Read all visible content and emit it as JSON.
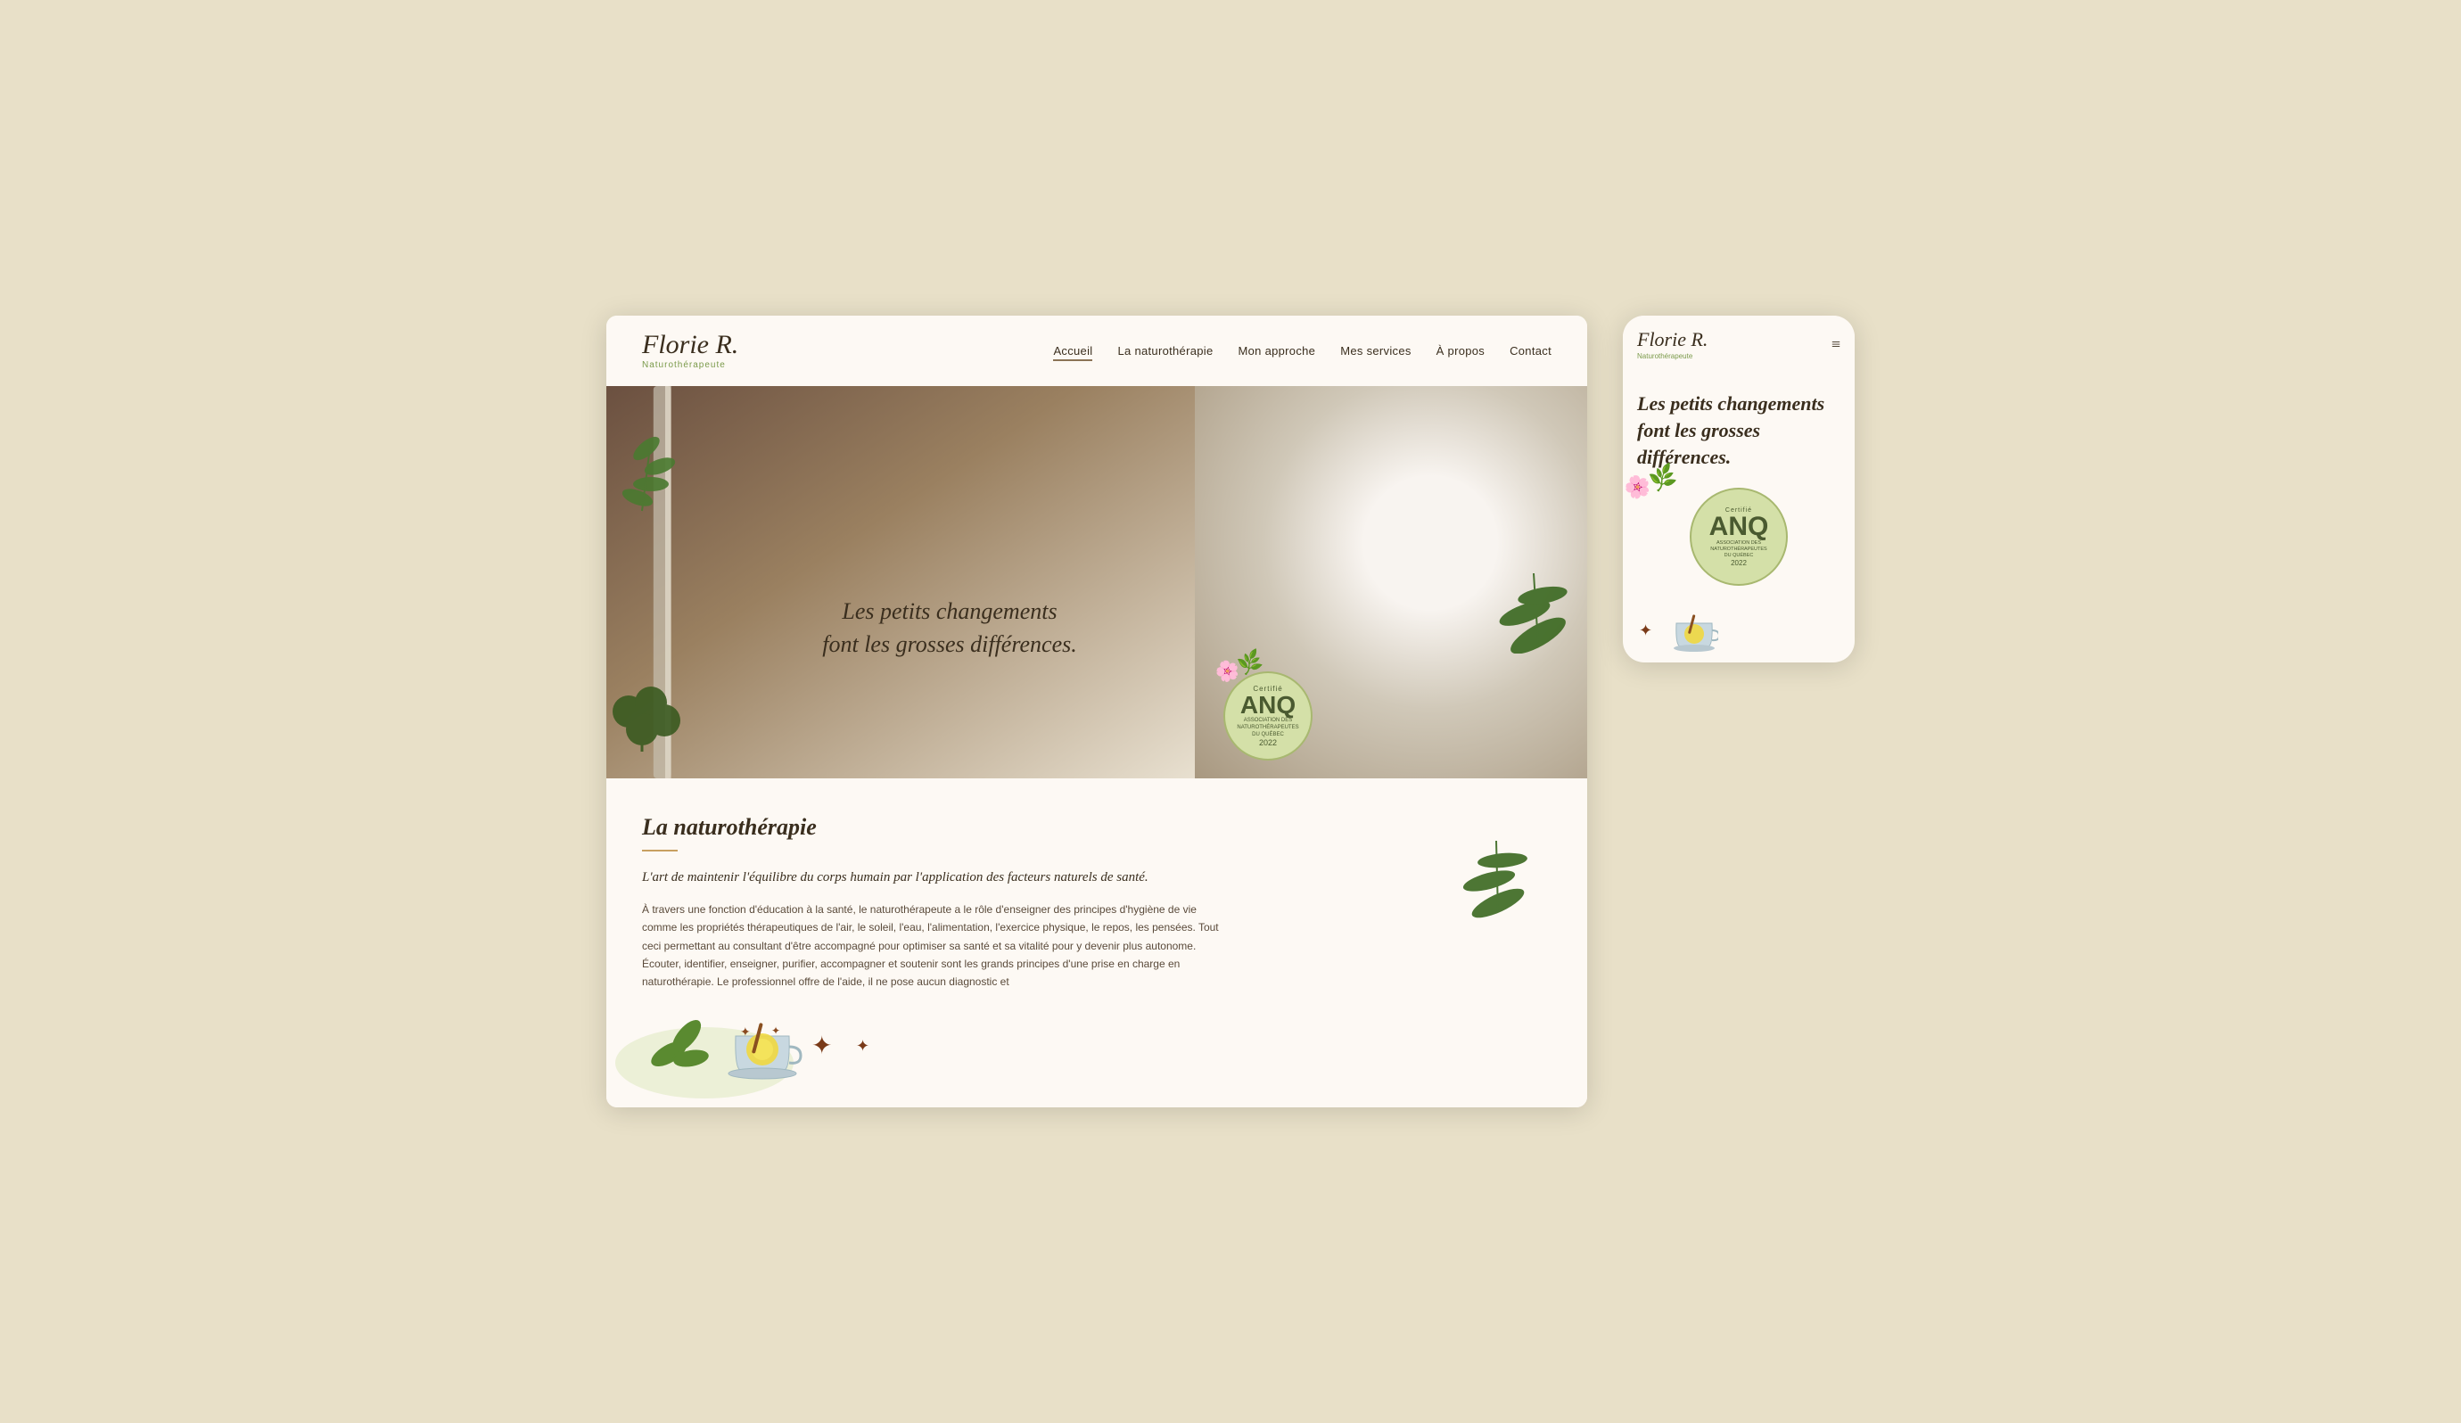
{
  "desktop": {
    "logo": {
      "name": "Florie R.",
      "subtitle": "Naturothérapeute"
    },
    "nav": {
      "links": [
        {
          "label": "Accueil",
          "active": true
        },
        {
          "label": "La naturothérapie",
          "active": false
        },
        {
          "label": "Mon approche",
          "active": false
        },
        {
          "label": "Mes services",
          "active": false
        },
        {
          "label": "À propos",
          "active": false
        },
        {
          "label": "Contact",
          "active": false
        }
      ]
    },
    "hero": {
      "title_line1": "Les petits changements",
      "title_line2": "font les grosses différences."
    },
    "badge": {
      "certifie": "Certifié",
      "anq": "ANQ",
      "association_line1": "ASSOCIATION DES",
      "association_line2": "NATUROTHÉRAPEUTES",
      "association_line3": "DU QUÉBEC",
      "year": "2022"
    },
    "section": {
      "title": "La naturothérapie",
      "subtitle": "L'art de maintenir l'équilibre du corps humain par l'application des facteurs naturels de santé.",
      "body": "À travers une fonction d'éducation à la santé, le naturothérapeute a le rôle d'enseigner des principes d'hygiène de vie comme les propriétés thérapeutiques de l'air, le soleil, l'eau, l'alimentation, l'exercice physique, le repos, les pensées. Tout ceci permettant au consultant d'être accompagné pour optimiser sa santé et sa vitalité pour y devenir plus autonome. Écouter, identifier, enseigner, purifier, accompagner et soutenir sont les grands principes d'une prise en charge en naturothérapie. Le professionnel offre de l'aide, il ne pose aucun diagnostic et"
    }
  },
  "mobile": {
    "logo": {
      "name": "Florie R.",
      "subtitle": "Naturothérapeute"
    },
    "hero": {
      "title_line1": "Les petits changements",
      "title_line2": "font les grosses",
      "title_line3": "différences."
    },
    "badge": {
      "certifie": "Certifié",
      "anq": "ANQ",
      "association_line1": "ASSOCIATION DES",
      "association_line2": "NATUROTHÉRAPEUTES",
      "association_line3": "DU QUÉBEC",
      "year": "2022"
    },
    "hamburger": "≡"
  },
  "colors": {
    "background": "#e8e0c8",
    "card_bg": "#fdf9f4",
    "logo_color": "#3a2e1e",
    "green_accent": "#7a9a4a",
    "badge_bg": "#d4e0a8",
    "badge_border": "#a8b870",
    "badge_text": "#4a5a30",
    "title_color": "#3a2e1e",
    "text_color": "#5a4a3a",
    "underline_color": "#c8a060"
  }
}
